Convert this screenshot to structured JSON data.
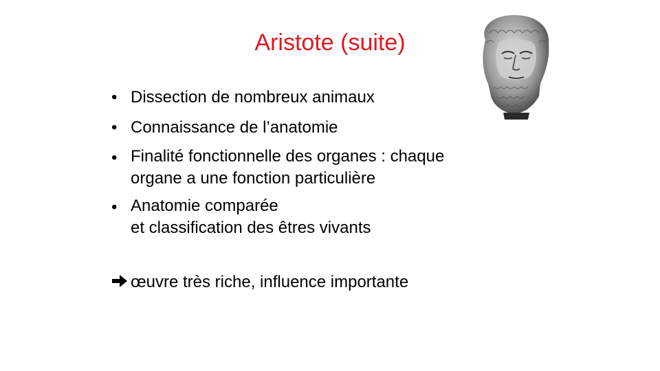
{
  "slide": {
    "title": "Aristote (suite)",
    "title_color": "#e0191f",
    "bust_icon": "aristotle-bust-image",
    "bullets": [
      {
        "lines": [
          "Dissection de nombreux animaux"
        ]
      },
      {
        "lines": [
          "Connaissance de l’anatomie"
        ]
      },
      {
        "lines": [
          "Finalité fonctionnelle des organes : chaque",
          "organe a une fonction particulière"
        ]
      },
      {
        "lines": [
          "Anatomie comparée",
          "et classification des êtres vivants"
        ]
      }
    ],
    "bullet_symbol": "•",
    "conclusion": "œuvre très riche, influence importante",
    "conclusion_icon": "right-arrow-icon"
  }
}
